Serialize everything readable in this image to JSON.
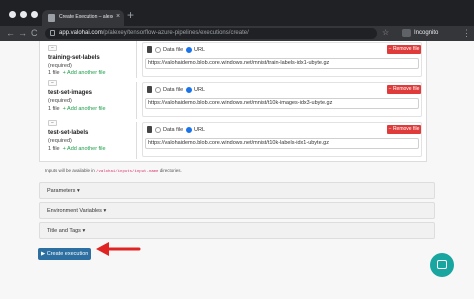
{
  "browser": {
    "tab_title": "Create Execution – alexey/tensor...",
    "tab_close": "×",
    "new_tab": "+",
    "nav_back": "←",
    "nav_forward": "→",
    "nav_reload": "C",
    "url_host": "app.valohai.com",
    "url_path": "/p/alexey/tensorflow-azure-pipelines/executions/create/",
    "star": "☆",
    "incognito_label": "Incognito",
    "menu": "⋮"
  },
  "inputs": [
    {
      "name": "training-set-labels",
      "required": "(required)",
      "count": "1 file",
      "add_label": "+ Add another file",
      "collapse": "−",
      "source_data": "Data file",
      "source_url": "URL",
      "remove_label": "− Remove file",
      "url": "https://valohaidemo.blob.core.windows.net/mnist/train-labels-idx1-ubyte.gz"
    },
    {
      "name": "test-set-images",
      "required": "(required)",
      "count": "1 file",
      "add_label": "+ Add another file",
      "collapse": "−",
      "source_data": "Data file",
      "source_url": "URL",
      "remove_label": "− Remove file",
      "url": "https://valohaidemo.blob.core.windows.net/mnist/t10k-images-idx3-ubyte.gz"
    },
    {
      "name": "test-set-labels",
      "required": "(required)",
      "count": "1 file",
      "add_label": "+ Add another file",
      "collapse": "−",
      "source_data": "Data file",
      "source_url": "URL",
      "remove_label": "− Remove file",
      "url": "https://valohaidemo.blob.core.windows.net/mnist/t10k-labels-idx1-ubyte.gz"
    }
  ],
  "note": {
    "before": "Inputs will be available in",
    "path": "/valohai/inputs/input-name",
    "after": "directories."
  },
  "sections": {
    "parameters": "Parameters ▾",
    "env_vars": "Environment Variables ▾",
    "title_tags": "Title and Tags ▾"
  },
  "create_button": "▶ Create execution",
  "colors": {
    "primary": "#2c6fa0",
    "danger": "#e03b3b",
    "success": "#1c9e4a",
    "annotation_arrow": "#e02424",
    "chat": "#19a5a0"
  },
  "icons": [
    "lock-icon",
    "star-icon",
    "incognito-icon",
    "file-icon",
    "chat-icon",
    "annotation-arrow"
  ]
}
